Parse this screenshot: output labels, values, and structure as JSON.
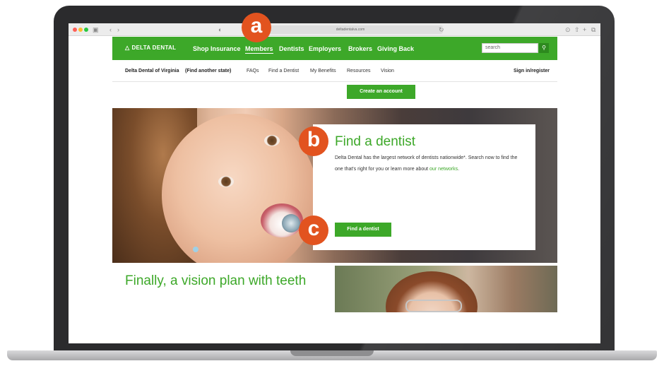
{
  "browser": {
    "url": "deltadentalva.com"
  },
  "site": {
    "logo": "DELTA DENTAL",
    "nav": [
      {
        "label": "Shop Insurance"
      },
      {
        "label": "Members"
      },
      {
        "label": "Dentists"
      },
      {
        "label": "Employers"
      },
      {
        "label": "Brokers"
      },
      {
        "label": "Giving Back"
      }
    ],
    "search": {
      "value": "search",
      "button_icon": "search-icon"
    },
    "subnav": {
      "state": "Delta Dental of Virginia",
      "change_state": "(Find another state)",
      "items": [
        "FAQs",
        "Find a Dentist",
        "My Benefits",
        "Resources",
        "Vision"
      ],
      "signin": "Sign in/register"
    },
    "create_account": "Create an account"
  },
  "hero": {
    "title": "Find a dentist",
    "body": "Delta Dental has the largest network of dentists nationwide*. Search now to find the one that's right for you or learn more about",
    "link": "our networks",
    "body_end": ".",
    "button": "Find a dentist"
  },
  "vision": {
    "title": "Finally, a vision plan with teeth"
  },
  "annotations": [
    "a",
    "b",
    "c"
  ],
  "colors": {
    "brand_green": "#3da829",
    "annotation_orange": "#e2531f"
  }
}
